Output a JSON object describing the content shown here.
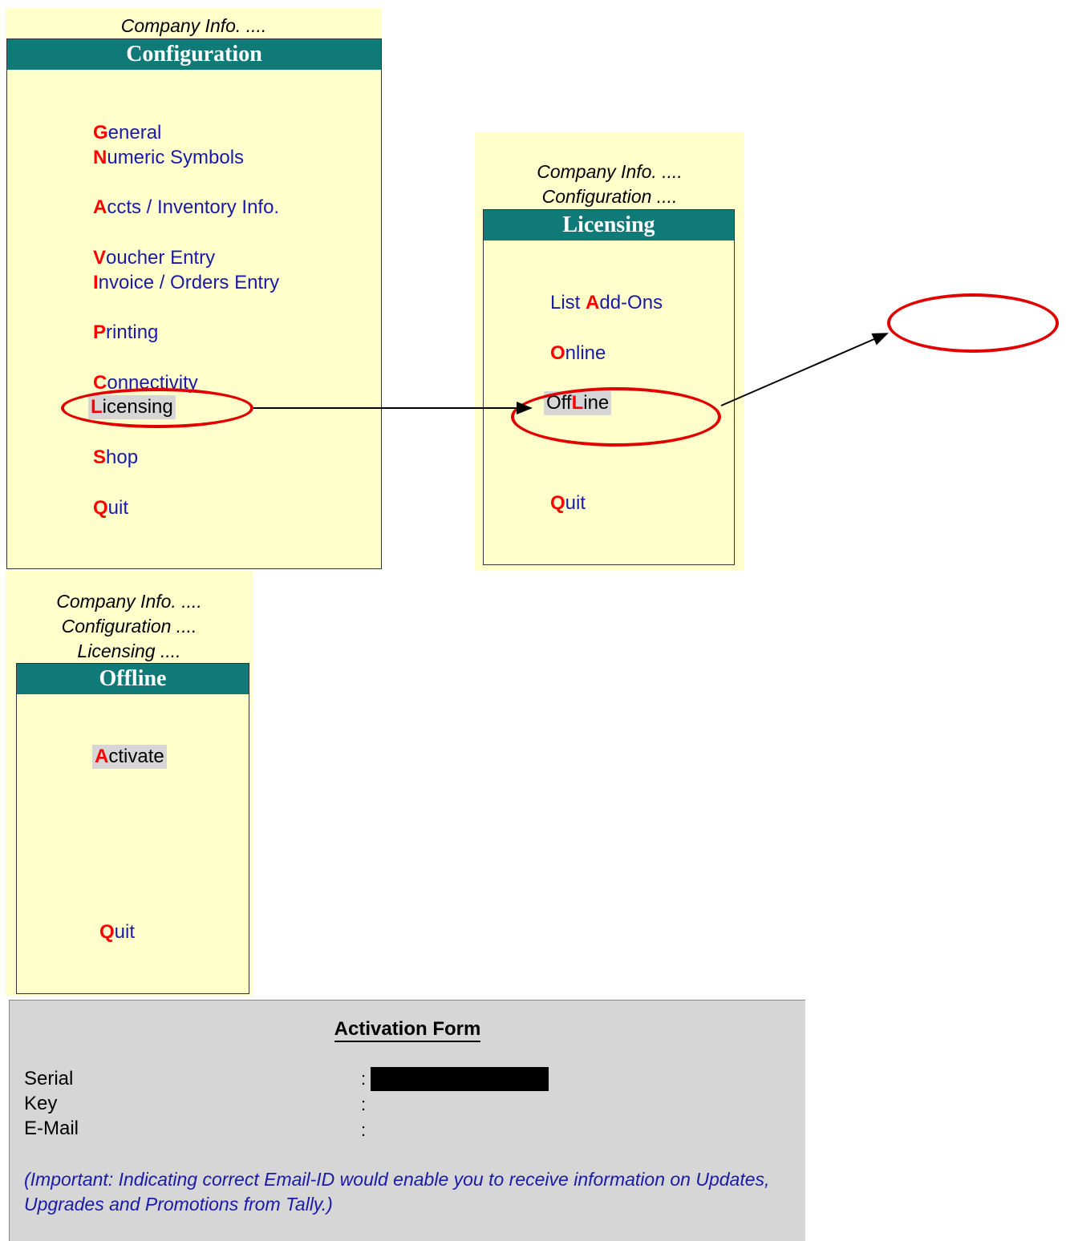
{
  "config_menu": {
    "breadcrumbs": [
      "Company Info. ...."
    ],
    "title": "Configuration",
    "items": [
      {
        "hotkey": "G",
        "rest": "eneral"
      },
      {
        "hotkey": "N",
        "rest": "umeric Symbols"
      },
      {
        "hotkey": "A",
        "rest": "ccts / Inventory Info."
      },
      {
        "hotkey": "V",
        "rest": "oucher Entry"
      },
      {
        "hotkey": "I",
        "rest": "nvoice / Orders Entry"
      },
      {
        "hotkey": "P",
        "rest": "rinting"
      },
      {
        "hotkey": "C",
        "rest": "onnectivity"
      },
      {
        "hotkey": "L",
        "rest": "icensing"
      },
      {
        "hotkey": "S",
        "rest": "hop"
      },
      {
        "hotkey": "Q",
        "rest": "uit"
      }
    ],
    "selected": "Licensing"
  },
  "licensing_menu": {
    "breadcrumbs": [
      "Company Info. ....",
      "Configuration ...."
    ],
    "title": "Licensing",
    "items": [
      {
        "pre": "List ",
        "hotkey": "A",
        "rest": "dd-Ons"
      },
      {
        "pre": "",
        "hotkey": "O",
        "rest": "nline"
      },
      {
        "pre": "Off",
        "hotkey": "L",
        "rest": "ine"
      },
      {
        "pre": "",
        "hotkey": "Q",
        "rest": "uit"
      }
    ],
    "selected": "OffLine"
  },
  "offline_menu": {
    "breadcrumbs": [
      "Company Info. ....",
      "Configuration ....",
      "Licensing ...."
    ],
    "title": "Offline",
    "items": [
      {
        "hotkey": "A",
        "rest": "ctivate"
      },
      {
        "hotkey": "Q",
        "rest": "uit"
      }
    ],
    "selected": "Activate"
  },
  "activation_form": {
    "title": "Activation Form",
    "fields": [
      {
        "label": "Serial",
        "colon": ":"
      },
      {
        "label": "Key",
        "colon": ":"
      },
      {
        "label": "E-Mail",
        "colon": ":"
      }
    ],
    "note": "(Important: Indicating correct Email-ID would enable you to receive information on Updates, Upgrades and Promotions from Tally.)"
  },
  "colors": {
    "panel": "#ffffcc",
    "header": "#0f7a78",
    "hotkey": "#ff0000",
    "item_text": "#1a1aa8",
    "highlight": "#d6d6d6",
    "annotation": "#e00000"
  }
}
